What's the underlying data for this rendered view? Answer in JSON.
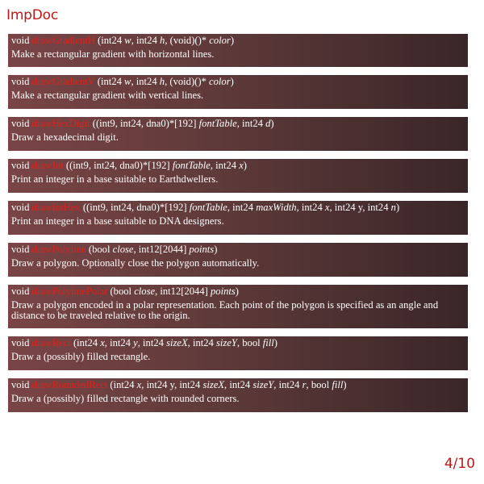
{
  "app": {
    "title": "ImpDoc"
  },
  "colors": {
    "accent": "#c01818",
    "function_name": "#e0201a",
    "card_light": "#7a4446",
    "card_dark": "#3a2628"
  },
  "functions": [
    {
      "return_type": "void",
      "name": "drawGradientH",
      "params": [
        {
          "type": "int24 ",
          "name": "w",
          "sep": ", "
        },
        {
          "type": "int24 ",
          "name": "h",
          "sep": ", "
        },
        {
          "type": "(void)()* ",
          "name": "color",
          "sep": ""
        }
      ],
      "description": "Make a rectangular gradient with horizontal lines."
    },
    {
      "return_type": "void",
      "name": "drawGradientV",
      "params": [
        {
          "type": "int24 ",
          "name": "w",
          "sep": ", "
        },
        {
          "type": "int24 ",
          "name": "h",
          "sep": ", "
        },
        {
          "type": "(void)()* ",
          "name": "color",
          "sep": ""
        }
      ],
      "description": "Make a rectangular gradient with vertical lines."
    },
    {
      "return_type": "void",
      "name": "drawHexDigit",
      "params": [
        {
          "type": "(int9, int24, dna0)*[192] ",
          "name": "fontTable",
          "sep": ", "
        },
        {
          "type": "int24 ",
          "name": "d",
          "sep": ""
        }
      ],
      "description": "Draw a hexadecimal digit."
    },
    {
      "return_type": "void",
      "name": "drawInt",
      "params": [
        {
          "type": "(int9, int24, dna0)*[192] ",
          "name": "fontTable",
          "sep": ", "
        },
        {
          "type": "int24 ",
          "name": "x",
          "sep": ""
        }
      ],
      "description": "Print an integer in a base suitable to Earthdwellers."
    },
    {
      "return_type": "void",
      "name": "drawIntHex",
      "params": [
        {
          "type": "(int9, int24, dna0)*[192] ",
          "name": "fontTable",
          "sep": ", "
        },
        {
          "type": "int24 ",
          "name": "maxWidth",
          "sep": ", "
        },
        {
          "type": "int24 ",
          "name": "x",
          "sep": ", "
        },
        {
          "type": "int24 ",
          "name": "y",
          "sep": ", "
        },
        {
          "type": "int24 ",
          "name": "n",
          "sep": ""
        }
      ],
      "description": "Print an integer in a base suitable to DNA designers."
    },
    {
      "return_type": "void",
      "name": "drawPolyline",
      "params": [
        {
          "type": "bool ",
          "name": "close",
          "sep": ", "
        },
        {
          "type": "int12[2044] ",
          "name": "points",
          "sep": ""
        }
      ],
      "description": "Draw a polygon. Optionally close the polygon automatically."
    },
    {
      "return_type": "void",
      "name": "drawPolylinePolar",
      "params": [
        {
          "type": "bool ",
          "name": "close",
          "sep": ", "
        },
        {
          "type": "int12[2044] ",
          "name": "points",
          "sep": ""
        }
      ],
      "description": "Draw a polygon encoded in a polar representation. Each point of the polygon is specified as an angle and distance to be traveled relative to the origin."
    },
    {
      "return_type": "void",
      "name": "drawRect",
      "params": [
        {
          "type": "int24 ",
          "name": "x",
          "sep": ", "
        },
        {
          "type": "int24 ",
          "name": "y",
          "sep": ", "
        },
        {
          "type": "int24 ",
          "name": "sizeX",
          "sep": ", "
        },
        {
          "type": "int24 ",
          "name": "sizeY",
          "sep": ", "
        },
        {
          "type": "bool ",
          "name": "fill",
          "sep": ""
        }
      ],
      "description": "Draw a (possibly) filled rectangle."
    },
    {
      "return_type": "void",
      "name": "drawRoundedRect",
      "params": [
        {
          "type": "int24 ",
          "name": "x",
          "sep": ", "
        },
        {
          "type": "int24 ",
          "name": "y",
          "sep": ", "
        },
        {
          "type": "int24 ",
          "name": "sizeX",
          "sep": ", "
        },
        {
          "type": "int24 ",
          "name": "sizeY",
          "sep": ", "
        },
        {
          "type": "int24 ",
          "name": "r",
          "sep": ", "
        },
        {
          "type": "bool ",
          "name": "fill",
          "sep": ""
        }
      ],
      "description": "Draw a (possibly) filled rectangle with rounded corners."
    }
  ],
  "pagination": {
    "label": "4/10"
  }
}
